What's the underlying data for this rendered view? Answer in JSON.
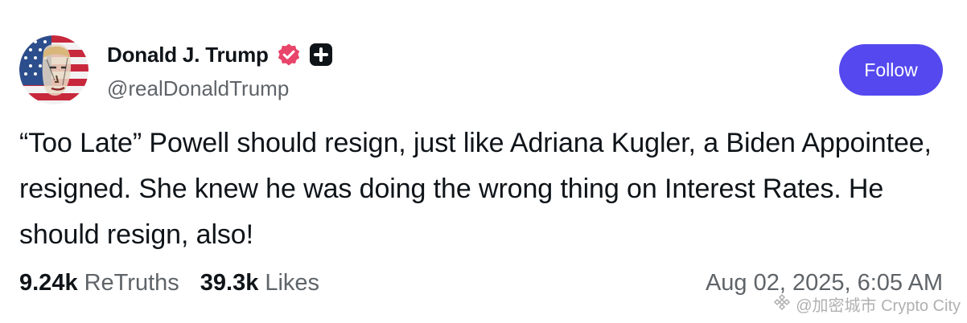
{
  "post": {
    "author": {
      "display_name": "Donald J. Trump",
      "handle": "@realDonaldTrump",
      "verified_icon": "verified-badge-icon",
      "plus_icon": "plus-badge-icon"
    },
    "follow_label": "Follow",
    "text": "“Too Late” Powell should resign, just like Adriana Kugler, a Biden Appointee, resigned. She knew he was doing the wrong thing on Interest Rates. He should resign, also!",
    "stats": {
      "retruths_count": "9.24k",
      "retruths_label": "ReTruths",
      "likes_count": "39.3k",
      "likes_label": "Likes"
    },
    "timestamp": "Aug 02, 2025, 6:05 AM"
  },
  "watermark": {
    "text": "@加密城市 Crypto City"
  },
  "colors": {
    "accent": "#5448ee",
    "verified": "#e8456a",
    "muted_text": "#5f6469",
    "primary_text": "#0f1419"
  }
}
